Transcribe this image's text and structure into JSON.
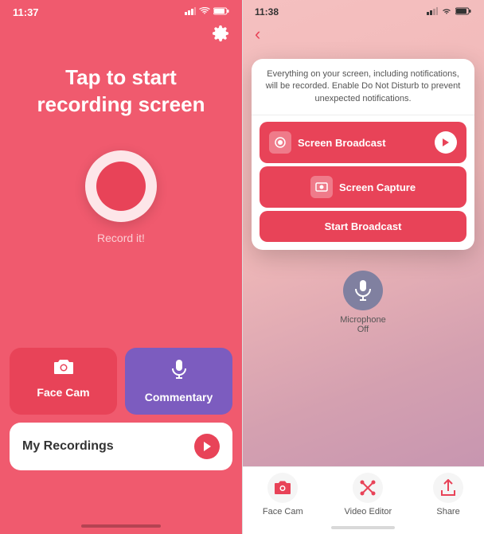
{
  "left": {
    "status": {
      "time": "11:37",
      "signal": "●●●",
      "wifi": "wifi",
      "battery": "🔋"
    },
    "title_line1": "Tap to start",
    "title_line2": "recording screen",
    "record_label": "Record it!",
    "buttons": {
      "face_cam": "Face Cam",
      "commentary": "Commentary",
      "my_recordings": "My Recordings"
    }
  },
  "right": {
    "status": {
      "time": "11:38",
      "signal": "●●",
      "wifi": "wifi",
      "battery": "🔋"
    },
    "back_icon": "‹",
    "modal": {
      "description": "Everything on your screen, including notifications, will be recorded. Enable Do Not Disturb to prevent unexpected notifications.",
      "screen_broadcast": "Screen Broadcast",
      "screen_capture": "Screen Capture",
      "start_broadcast": "Start Broadcast"
    },
    "mic": {
      "label_line1": "Microphone",
      "label_line2": "Off"
    },
    "tabs": [
      {
        "label": "Face Cam",
        "icon": "camera"
      },
      {
        "label": "Video Editor",
        "icon": "scissors"
      },
      {
        "label": "Share",
        "icon": "share"
      }
    ]
  },
  "colors": {
    "primary_red": "#e84358",
    "purple": "#7c5cbf",
    "dark_red": "#f05a6e"
  }
}
